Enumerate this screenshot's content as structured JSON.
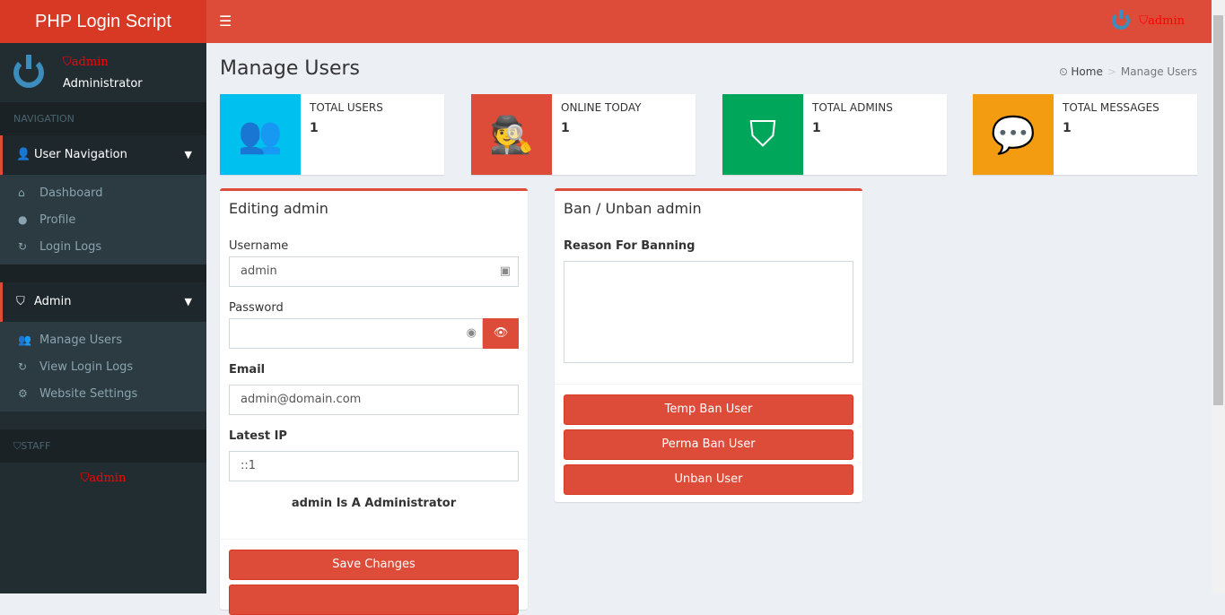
{
  "app": {
    "title": "PHP Login Script"
  },
  "user": {
    "name": "admin",
    "role": "Administrator"
  },
  "sidebar": {
    "nav_header": "NAVIGATION",
    "groups": [
      {
        "label": "User Navigation",
        "items": [
          "Dashboard",
          "Profile",
          "Login Logs"
        ]
      },
      {
        "label": "Admin",
        "items": [
          "Manage Users",
          "View Login Logs",
          "Website Settings"
        ]
      }
    ],
    "staff_header": "STAFF",
    "staff": [
      "admin"
    ]
  },
  "page": {
    "title": "Manage Users",
    "breadcrumb": [
      "Home",
      "Manage Users"
    ]
  },
  "stats": [
    {
      "label": "TOTAL USERS",
      "value": "1",
      "color": "#00c0ef"
    },
    {
      "label": "ONLINE TODAY",
      "value": "1",
      "color": "#dd4b39"
    },
    {
      "label": "TOTAL ADMINS",
      "value": "1",
      "color": "#00a65a"
    },
    {
      "label": "TOTAL MESSAGES",
      "value": "1",
      "color": "#f39c12"
    }
  ],
  "edit": {
    "title": "Editing admin",
    "username_label": "Username",
    "username": "admin",
    "password_label": "Password",
    "password": "",
    "email_label": "Email",
    "email": "admin@domain.com",
    "ip_label": "Latest IP",
    "ip": "::1",
    "status": "admin Is A Administrator",
    "save": "Save Changes"
  },
  "ban": {
    "title": "Ban / Unban admin",
    "reason_label": "Reason For Banning",
    "reason": "",
    "temp": "Temp Ban User",
    "perma": "Perma Ban User",
    "unban": "Unban User"
  }
}
